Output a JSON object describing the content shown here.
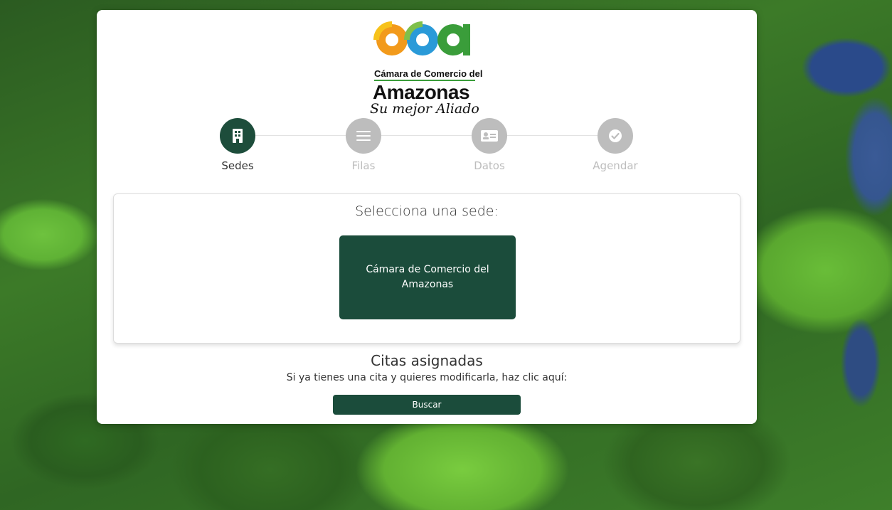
{
  "logo": {
    "line1": "Cámara de Comercio del",
    "line2": "Amazonas",
    "slogan": "Su mejor Aliado"
  },
  "steps": [
    {
      "label": "Sedes",
      "icon": "building-icon",
      "active": true
    },
    {
      "label": "Filas",
      "icon": "list-icon",
      "active": false
    },
    {
      "label": "Datos",
      "icon": "id-card-icon",
      "active": false
    },
    {
      "label": "Agendar",
      "icon": "check-circle-icon",
      "active": false
    }
  ],
  "sede_panel": {
    "title": "Selecciona una sede:",
    "sede_button_label": "Cámara de Comercio del Amazonas"
  },
  "citas": {
    "title": "Citas asignadas",
    "subtitle": "Si ya tienes una cita y quieres modificarla, haz clic aquí:",
    "button_label": "Buscar"
  },
  "colors": {
    "primary": "#1b4c3b",
    "inactive_step": "#bdbdbd",
    "logo_orange": "#f29a1b",
    "logo_blue": "#2a9ad8",
    "logo_green": "#3a9d3a"
  }
}
